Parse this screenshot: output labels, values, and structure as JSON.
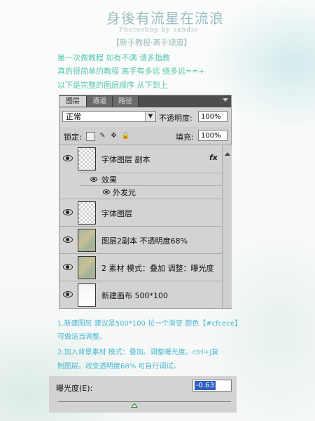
{
  "header": {
    "title_cn": "身後有流星在流浪",
    "title_en": "Photoshop  by  sandio",
    "subtitle": "【新手教程·高手绕道】"
  },
  "intro": [
    "第一次做教程 如有不满 请多指教",
    "真的很简单的教程 高手有多远 绕多远==+",
    "以下是完整的图层顺序 从下到上"
  ],
  "panel": {
    "tabs": [
      "图层",
      "通道",
      "路径"
    ],
    "blend_mode": "正常",
    "opacity_label": "不透明度:",
    "opacity_value": "100%",
    "lock_label": "锁定:",
    "fill_label": "填充:",
    "fill_value": "100%",
    "effects_label": "效果",
    "effect_name": "外发光",
    "fx_label": "fx",
    "layers": [
      {
        "name": "字体图层 副本",
        "thumb": "checker"
      },
      {
        "name": "字体图层",
        "thumb": "checker"
      },
      {
        "name": "图层2副本 不透明度68%",
        "thumb": "texture"
      },
      {
        "name": "2 素材 模式：叠加 调整：曝光度",
        "thumb": "texture"
      },
      {
        "name": "新建画布 500*100",
        "thumb": "gradient"
      }
    ]
  },
  "steps": [
    "1.新建图层 建议是500*100  拉一个渐变 颜色【#cfcece】",
    "可做适当调整。",
    "2.加入背景素材 模式：叠加。调整曝光度。ctrl+J复",
    "制图层。改变透明度68% 可自行调试。"
  ],
  "exposure": {
    "label": "曝光度(E):",
    "value": "-0.63",
    "slider_fraction": 0.44
  },
  "colors": {
    "intro_text": "#57c7b0",
    "step_text": "#49b6d0",
    "selection": "#2f5fc4"
  }
}
